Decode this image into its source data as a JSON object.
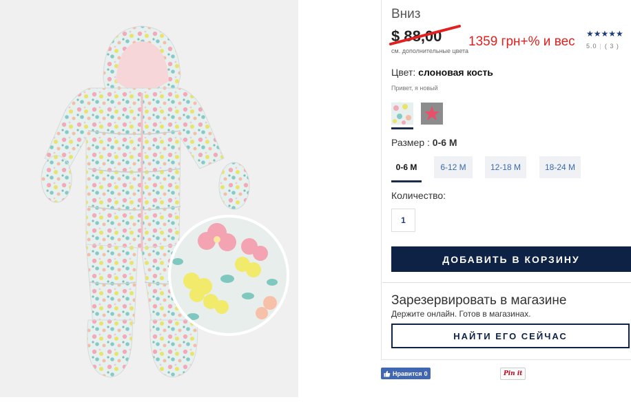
{
  "product": {
    "title": "Вниз",
    "price": "$ 88,00",
    "note": "1359 грн+% и вес",
    "more_colors": "см. дополнительные цвета",
    "stars": "★★★★★",
    "rating": "5.0",
    "reviews": "( 3 )"
  },
  "color": {
    "label": "Цвет: ",
    "value": "слоновая кость",
    "tagline": "Привет, я новый",
    "swatches": [
      "floral-print",
      "gray-with-red-star"
    ]
  },
  "size": {
    "label": "Размер : ",
    "value": "0-6 M",
    "options": [
      "0-6 M",
      "6-12 M",
      "12-18 M",
      "18-24 M"
    ],
    "selected_index": 0
  },
  "quantity": {
    "label": "Количество:",
    "value": "1"
  },
  "actions": {
    "add_to_cart": "ДОБАВИТЬ В КОРЗИНУ"
  },
  "reserve": {
    "title": "Зарезервировать в магазине",
    "subtitle": "Держите онлайн. Готов в магазинах.",
    "button": "НАЙТИ ЕГО СЕЙЧАС"
  },
  "social": {
    "fb_label": "Нравится",
    "fb_count": "0",
    "pin_label": "Pin it"
  },
  "colors": {
    "navy": "#0d2244",
    "link_blue": "#3a6ab0",
    "note_red": "#e0201d",
    "strike_red": "#e32020"
  },
  "icons": [
    "thumbs-up-icon",
    "star-icon"
  ]
}
